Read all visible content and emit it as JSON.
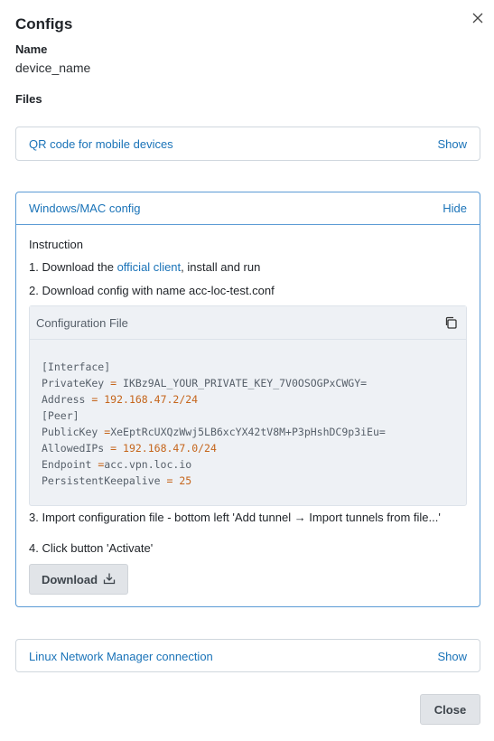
{
  "dialog": {
    "title": "Configs",
    "name_label": "Name",
    "name_value": "device_name",
    "files_label": "Files",
    "close_button": "Close"
  },
  "qr": {
    "title": "QR code for mobile devices",
    "toggle": "Show"
  },
  "windows": {
    "title": "Windows/MAC config",
    "toggle": "Hide",
    "instruction_title": "Instruction",
    "step1_prefix": "1. Download the ",
    "step1_link": "official client",
    "step1_suffix": ", install and run",
    "step2": "2. Download config with name acc-loc-test.conf",
    "step3": "3. Import configuration file - bottom left 'Add tunnel → Import tunnels from file...'",
    "step4": "4. Click button 'Activate'",
    "download_button": "Download",
    "config_file": {
      "title": "Configuration File",
      "lines": [
        {
          "key": "[Interface]",
          "op": "",
          "value": ""
        },
        {
          "key": "PrivateKey ",
          "op": "=",
          "value": " IKBz9AL_YOUR_PRIVATE_KEY_7V0OSOGPxCWGY="
        },
        {
          "key": "Address ",
          "op": "=",
          "value": " 192.168.47.2/24"
        },
        {
          "key": "[Peer]",
          "op": "",
          "value": ""
        },
        {
          "key": "PublicKey ",
          "op": "=",
          "value": "XeEptRcUXQzWwj5LB6xcYX42tV8M+P3pHshDC9p3iEu="
        },
        {
          "key": "AllowedIPs ",
          "op": "=",
          "value": " 192.168.47.0/24"
        },
        {
          "key": "Endpoint ",
          "op": "=",
          "value": "acc.vpn.loc.io"
        },
        {
          "key": "PersistentKeepalive ",
          "op": "=",
          "value": " 25"
        }
      ]
    }
  },
  "linux": {
    "title": "Linux Network Manager connection",
    "toggle": "Show"
  }
}
